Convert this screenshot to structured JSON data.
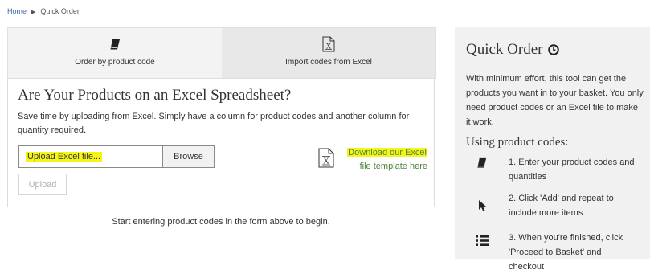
{
  "breadcrumb": {
    "home": "Home",
    "current": "Quick Order"
  },
  "tabs": [
    {
      "label": "Order by product code",
      "icon": "book-icon",
      "active": false
    },
    {
      "label": "Import codes from Excel",
      "icon": "excel-file-icon",
      "active": true
    }
  ],
  "import_panel": {
    "heading": "Are Your Products on an Excel Spreadsheet?",
    "description": "Save time by uploading from Excel. Simply have a column for product codes and another column for quantity required.",
    "file_input_value": "Upload Excel file...",
    "browse_label": "Browse",
    "upload_label": "Upload",
    "download_line1": "Download our Excel",
    "download_line2": "file template here"
  },
  "hint": "Start entering product codes in the form above to begin.",
  "sidebar": {
    "title": "Quick Order",
    "intro": "With minimum effort, this tool can get the products you want in to your basket. You only need product codes or an Excel file to make it work.",
    "subheading": "Using product codes:",
    "steps": [
      {
        "icon": "book-icon",
        "text": "1. Enter your product codes and quantities"
      },
      {
        "icon": "cursor-arrow-icon",
        "text": "2. Click 'Add' and repeat to include more items"
      },
      {
        "icon": "list-icon",
        "text": "3. When you're finished, click 'Proceed to Basket' and checkout"
      }
    ]
  },
  "colors": {
    "highlight": "#f5f51a",
    "link_green": "#4e8240",
    "link_blue": "#3a6aa8",
    "sidebar_bg": "#f1f1f1"
  }
}
